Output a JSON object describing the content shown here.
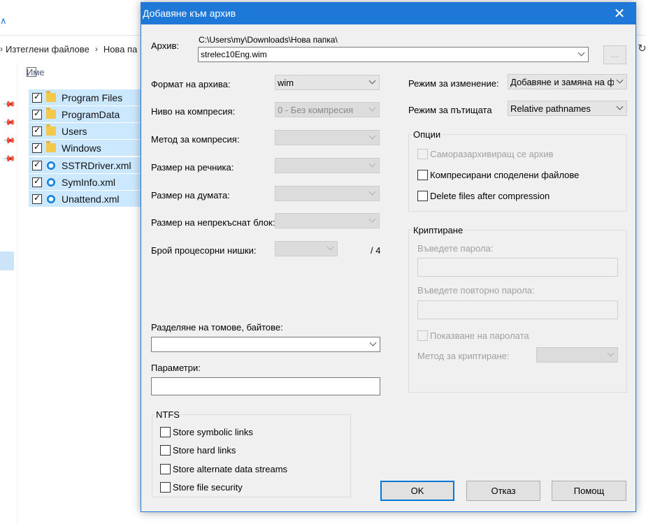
{
  "explorer": {
    "breadcrumb": [
      "Изтеглени файлове",
      "Нова па"
    ],
    "column_name": "Име",
    "files": [
      {
        "name": "Program Files",
        "icon": "folder-icon"
      },
      {
        "name": "ProgramData",
        "icon": "folder-icon"
      },
      {
        "name": "Users",
        "icon": "folder-icon"
      },
      {
        "name": "Windows",
        "icon": "folder-icon"
      },
      {
        "name": "SSTRDriver.xml",
        "icon": "xml-file-icon"
      },
      {
        "name": "SymInfo.xml",
        "icon": "xml-file-icon"
      },
      {
        "name": "Unattend.xml",
        "icon": "xml-file-icon"
      }
    ],
    "refresh_glyph": "↻",
    "top_glyph": "∧"
  },
  "dialog": {
    "title": "Добавяне към архив",
    "close_glyph": "✕",
    "archive": {
      "label": "Архив:",
      "path": "C:\\Users\\my\\Downloads\\Нова папка\\",
      "filename": "strelec10Eng.wim",
      "browse_label": "..."
    },
    "left": {
      "format_label": "Формат на архива:",
      "format_value": "wim",
      "level_label": "Ниво на компресия:",
      "level_value": "0 - Без компресия",
      "method_label": "Метод за компресия:",
      "dict_label": "Размер на речника:",
      "word_label": "Размер на думата:",
      "block_label": "Размер на непрекъснат блок:",
      "threads_label": "Брой процесорни нишки:",
      "threads_total": "/ 4",
      "split_label": "Разделяне на томове, байтове:",
      "params_label": "Параметри:"
    },
    "right": {
      "update_label": "Режим за изменение:",
      "update_value": "Добавяне и замяна на фа",
      "path_label": "Режим за пътищата",
      "path_value": "Relative pathnames"
    },
    "options": {
      "caption": "Опции",
      "sfx": "Саморазархивиращ се архив",
      "shared": "Компресирани споделени файлове",
      "delete": "Delete files after compression"
    },
    "encryption": {
      "caption": "Криптиране",
      "enter_pwd": "Въведете парола:",
      "reenter_pwd": "Въведете повторно парола:",
      "show_pwd": "Показване на паролата",
      "method_label": "Метод за криптиране:"
    },
    "ntfs": {
      "caption": "NTFS",
      "symlinks": "Store symbolic links",
      "hardlinks": "Store hard links",
      "ads": "Store alternate data streams",
      "security": "Store file security"
    },
    "buttons": {
      "ok": "OK",
      "cancel": "Отказ",
      "help": "Помощ"
    }
  }
}
